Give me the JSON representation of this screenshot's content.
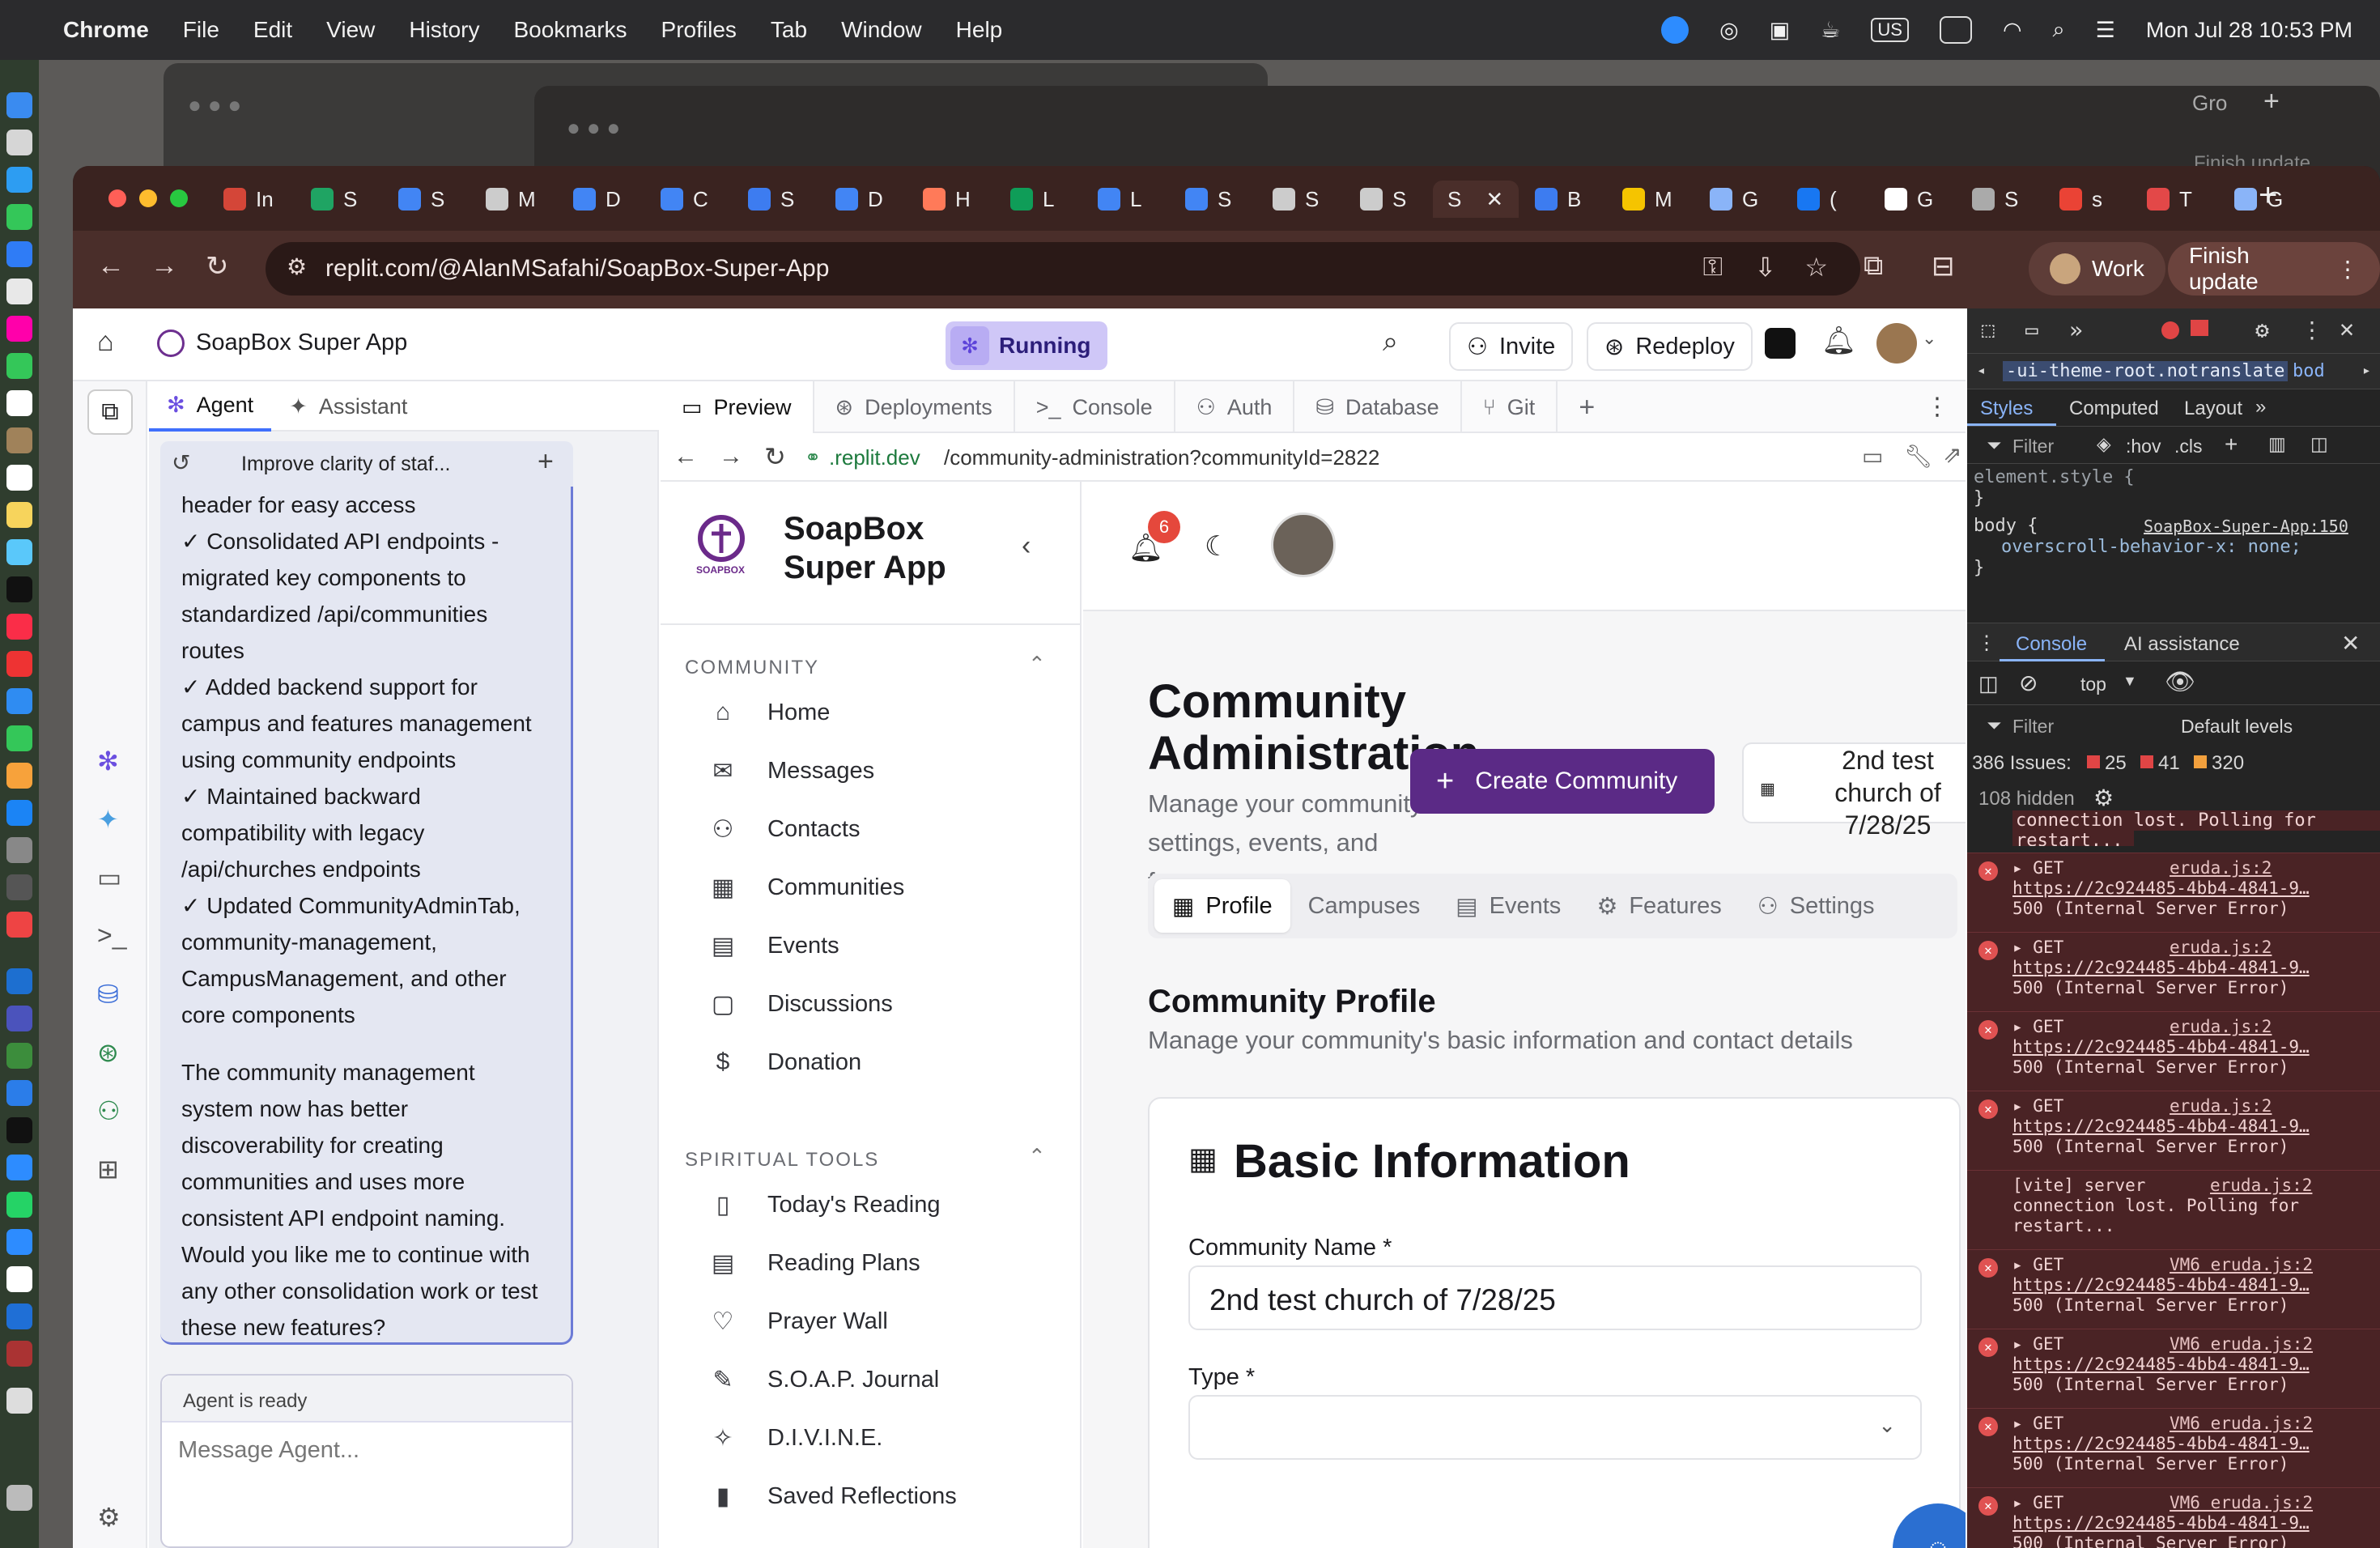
{
  "menubar": {
    "app": "Chrome",
    "items": [
      "File",
      "Edit",
      "View",
      "History",
      "Bookmarks",
      "Profiles",
      "Tab",
      "Window",
      "Help"
    ],
    "clock": "Mon Jul 28  10:53 PM",
    "input_source": "US"
  },
  "back_window": {
    "tab_text": "Gro",
    "finish_update": "Finish update"
  },
  "chrome": {
    "tabs": [
      {
        "label": "In",
        "color": "#d44638"
      },
      {
        "label": "S",
        "color": "#1fa463"
      },
      {
        "label": "S",
        "color": "#4285f4"
      },
      {
        "label": "M",
        "color": "#cccccc"
      },
      {
        "label": "D",
        "color": "#4285f4"
      },
      {
        "label": "C",
        "color": "#4285f4"
      },
      {
        "label": "S",
        "color": "#3d7cf0"
      },
      {
        "label": "D",
        "color": "#4285f4"
      },
      {
        "label": "H",
        "color": "#ff7a59"
      },
      {
        "label": "L",
        "color": "#0f9d58"
      },
      {
        "label": "L",
        "color": "#4285f4"
      },
      {
        "label": "S",
        "color": "#4285f4"
      },
      {
        "label": "S",
        "color": "#cccccc"
      },
      {
        "label": "S",
        "color": "#cccccc"
      },
      {
        "label": "B",
        "color": "#3d7cf0"
      },
      {
        "label": "M",
        "color": "#f5c400"
      },
      {
        "label": "G",
        "color": "#8ab4f8"
      },
      {
        "label": "(",
        "color": "#1877f2"
      },
      {
        "label": "G",
        "color": "#ffffff"
      },
      {
        "label": "S",
        "color": "#aaaaaa"
      },
      {
        "label": "s",
        "color": "#ea4335"
      },
      {
        "label": "T",
        "color": "#e34848"
      },
      {
        "label": "G",
        "color": "#8ab4f8"
      }
    ],
    "active_tab": "S",
    "url": "replit.com/@AlanMSafahi/SoapBox-Super-App",
    "profile": "Work",
    "finish_update": "Finish update"
  },
  "replit": {
    "project_name": "SoapBox Super App",
    "status": "Running",
    "invite": "Invite",
    "redeploy": "Redeploy",
    "agent_tabs": [
      "Agent",
      "Assistant"
    ],
    "chat_title": "Improve clarity of staf...",
    "chat_lines": [
      "header for easy access",
      "✓ Consolidated API endpoints -",
      "migrated key components to",
      "standardized /api/communities",
      "routes",
      "✓ Added backend support for",
      "campus and features management",
      "using community endpoints",
      "✓ Maintained backward",
      "compatibility with legacy",
      "/api/churches endpoints",
      "✓ Updated CommunityAdminTab,",
      "community-management,",
      "CampusManagement, and other",
      "core components"
    ],
    "chat_lines2": [
      "The community management",
      "system now has better",
      "discoverability for creating",
      "communities and uses more",
      "consistent API endpoint naming.",
      "Would you like me to continue with",
      "any other consolidation work or test",
      "these new features?"
    ],
    "agent_status": "Agent is ready",
    "message_placeholder": "Message Agent...",
    "preview_tabs": [
      "Preview",
      "Deployments",
      "Console",
      "Auth",
      "Database",
      "Git"
    ],
    "preview_url_domain": ".replit.dev",
    "preview_url_path": "/community-administration?communityId=2822"
  },
  "soapbox": {
    "brand_line1": "SoapBox",
    "brand_line2": "Super App",
    "logo_text": "SOAPBOX",
    "community_section": "COMMUNITY",
    "community_items": [
      "Home",
      "Messages",
      "Contacts",
      "Communities",
      "Events",
      "Discussions",
      "Donation"
    ],
    "spiritual_section": "SPIRITUAL TOOLS",
    "spiritual_items": [
      "Today's Reading",
      "Reading Plans",
      "Prayer Wall",
      "S.O.A.P. Journal",
      "D.I.V.I.N.E.",
      "Saved Reflections"
    ],
    "notification_count": "6",
    "page_title_line1": "Community",
    "page_title_line2": "Administration",
    "page_subtitle": [
      "Manage your community",
      "settings, events, and",
      "features"
    ],
    "create_button": "Create Community",
    "selected_community": [
      "2nd test",
      "church of",
      "7/28/25"
    ],
    "tabs": [
      "Profile",
      "Campuses",
      "Events",
      "Features",
      "Settings"
    ],
    "profile_heading": "Community Profile",
    "profile_desc": "Manage your community's basic information and contact details",
    "card_title": "Basic Information",
    "name_label": "Community Name *",
    "name_value": "2nd test church of 7/28/25",
    "type_label": "Type *"
  },
  "devtools": {
    "breadcrumb": "-ui-theme-root.notranslate",
    "breadcrumb2": "bod",
    "style_tabs": [
      "Styles",
      "Computed",
      "Layout"
    ],
    "filter": "Filter",
    "hov": ":hov",
    "cls": ".cls",
    "element_style": "element.style {",
    "close_brace": "}",
    "body_rule": "body {",
    "body_source": "SoapBox-Super-App:150",
    "body_prop": "overscroll-behavior-x: none;",
    "drawer_tabs": [
      "Console",
      "AI assistance"
    ],
    "context": "top",
    "levels": "Default levels",
    "issues_label": "386 Issues:",
    "issues_err": "25",
    "issues_warn": "41",
    "issues_info": "320",
    "hidden": "108 hidden",
    "truncated": [
      "connection lost. Polling for",
      "restart..."
    ],
    "errors": [
      {
        "method": "GET",
        "src": "eruda.js:2",
        "url": "https://2c924485-4bb4-4841-9…",
        "status": "500 (Internal Server Error)"
      },
      {
        "method": "GET",
        "src": "eruda.js:2",
        "url": "https://2c924485-4bb4-4841-9…",
        "status": "500 (Internal Server Error)"
      },
      {
        "method": "GET",
        "src": "eruda.js:2",
        "url": "https://2c924485-4bb4-4841-9…",
        "status": "500 (Internal Server Error)"
      },
      {
        "method": "GET",
        "src": "eruda.js:2",
        "url": "https://2c924485-4bb4-4841-9…",
        "status": "500 (Internal Server Error)"
      }
    ],
    "vite": [
      "[vite] server",
      "connection lost. Polling for",
      "restart..."
    ],
    "vite_src": "eruda.js:2",
    "errors2": [
      {
        "method": "GET",
        "src": "VM6 eruda.js:2",
        "url": "https://2c924485-4bb4-4841-9…",
        "status": "500 (Internal Server Error)"
      },
      {
        "method": "GET",
        "src": "VM6 eruda.js:2",
        "url": "https://2c924485-4bb4-4841-9…",
        "status": "500 (Internal Server Error)"
      },
      {
        "method": "GET",
        "src": "VM6 eruda.js:2",
        "url": "https://2c924485-4bb4-4841-9…",
        "status": "500 (Internal Server Error)"
      },
      {
        "method": "GET",
        "src": "VM6 eruda.js:2",
        "url": "https://2c924485-4bb4-4841-9…",
        "status": "500 (Internal Server Error)"
      }
    ]
  }
}
